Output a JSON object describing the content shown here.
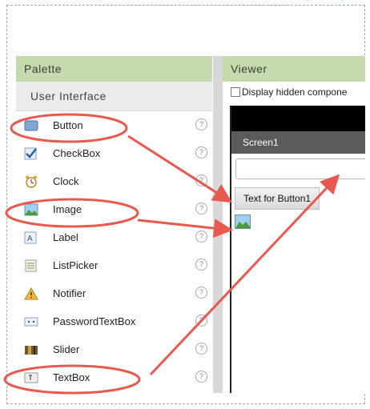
{
  "palette": {
    "title": "Palette",
    "section": "User Interface",
    "items": [
      {
        "label": "Button",
        "icon": "button-icon"
      },
      {
        "label": "CheckBox",
        "icon": "checkbox-icon"
      },
      {
        "label": "Clock",
        "icon": "clock-icon"
      },
      {
        "label": "Image",
        "icon": "image-icon"
      },
      {
        "label": "Label",
        "icon": "label-icon"
      },
      {
        "label": "ListPicker",
        "icon": "listpicker-icon"
      },
      {
        "label": "Notifier",
        "icon": "notifier-icon"
      },
      {
        "label": "PasswordTextBox",
        "icon": "passwordtextbox-icon"
      },
      {
        "label": "Slider",
        "icon": "slider-icon"
      },
      {
        "label": "TextBox",
        "icon": "textbox-icon"
      }
    ],
    "help_glyph": "?"
  },
  "viewer": {
    "title": "Viewer",
    "display_hidden_label": "Display hidden compone",
    "screen_title": "Screen1",
    "button_text": "Text for Button1"
  },
  "annotation_color": "#e8594f"
}
